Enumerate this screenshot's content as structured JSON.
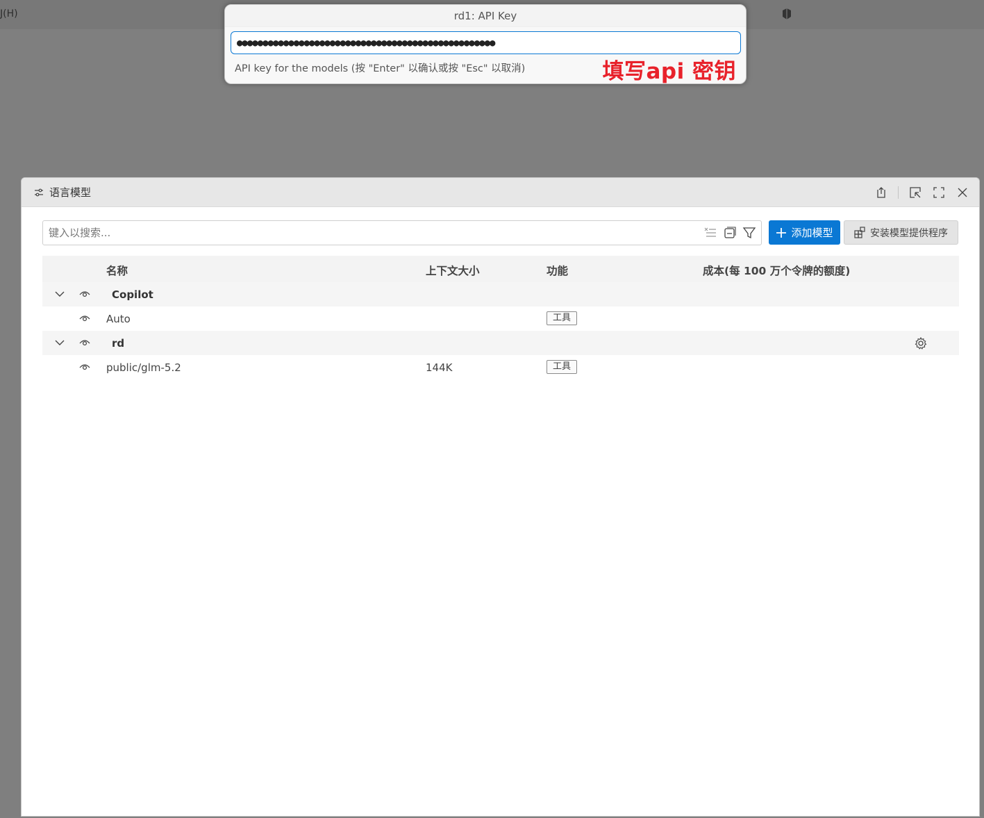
{
  "menubar": {
    "help_label": "J(H)"
  },
  "quick_input": {
    "title": "rd1: API Key",
    "value": "●●●●●●●●●●●●●●●●●●●●●●●●●●●●●●●●●●●●●●●●●●●●●●●●●●",
    "help": "API key for the models (按 \"Enter\" 以确认或按 \"Esc\" 以取消)",
    "annotation": "填写api 密钥"
  },
  "panel": {
    "title": "语言模型",
    "search_placeholder": "键入以搜索...",
    "add_button": "添加模型",
    "install_button": "安装模型提供程序",
    "columns": {
      "name": "名称",
      "context": "上下文大小",
      "capabilities": "功能",
      "cost": "成本(每 100 万个令牌的额度)"
    },
    "rows": [
      {
        "type": "group",
        "name": "Copilot"
      },
      {
        "type": "model",
        "name": "Auto",
        "context": "",
        "tag": "工具"
      },
      {
        "type": "group",
        "name": "rd"
      },
      {
        "type": "model",
        "name": "public/glm-5.2",
        "context": "144K",
        "tag": "工具"
      }
    ]
  },
  "icons": {
    "header": [
      "settings-sliders-icon",
      "export-icon",
      "pop-out-icon",
      "maximize-icon",
      "close-icon"
    ],
    "search": [
      "clear-filter-icon",
      "collapse-all-icon",
      "filter-icon"
    ],
    "rows": [
      "chevron-down-icon",
      "eye-icon",
      "gear-icon"
    ]
  },
  "colors": {
    "accent": "#0a78d4",
    "annotation": "#e8222b",
    "backdrop": "#7f7f7f"
  }
}
